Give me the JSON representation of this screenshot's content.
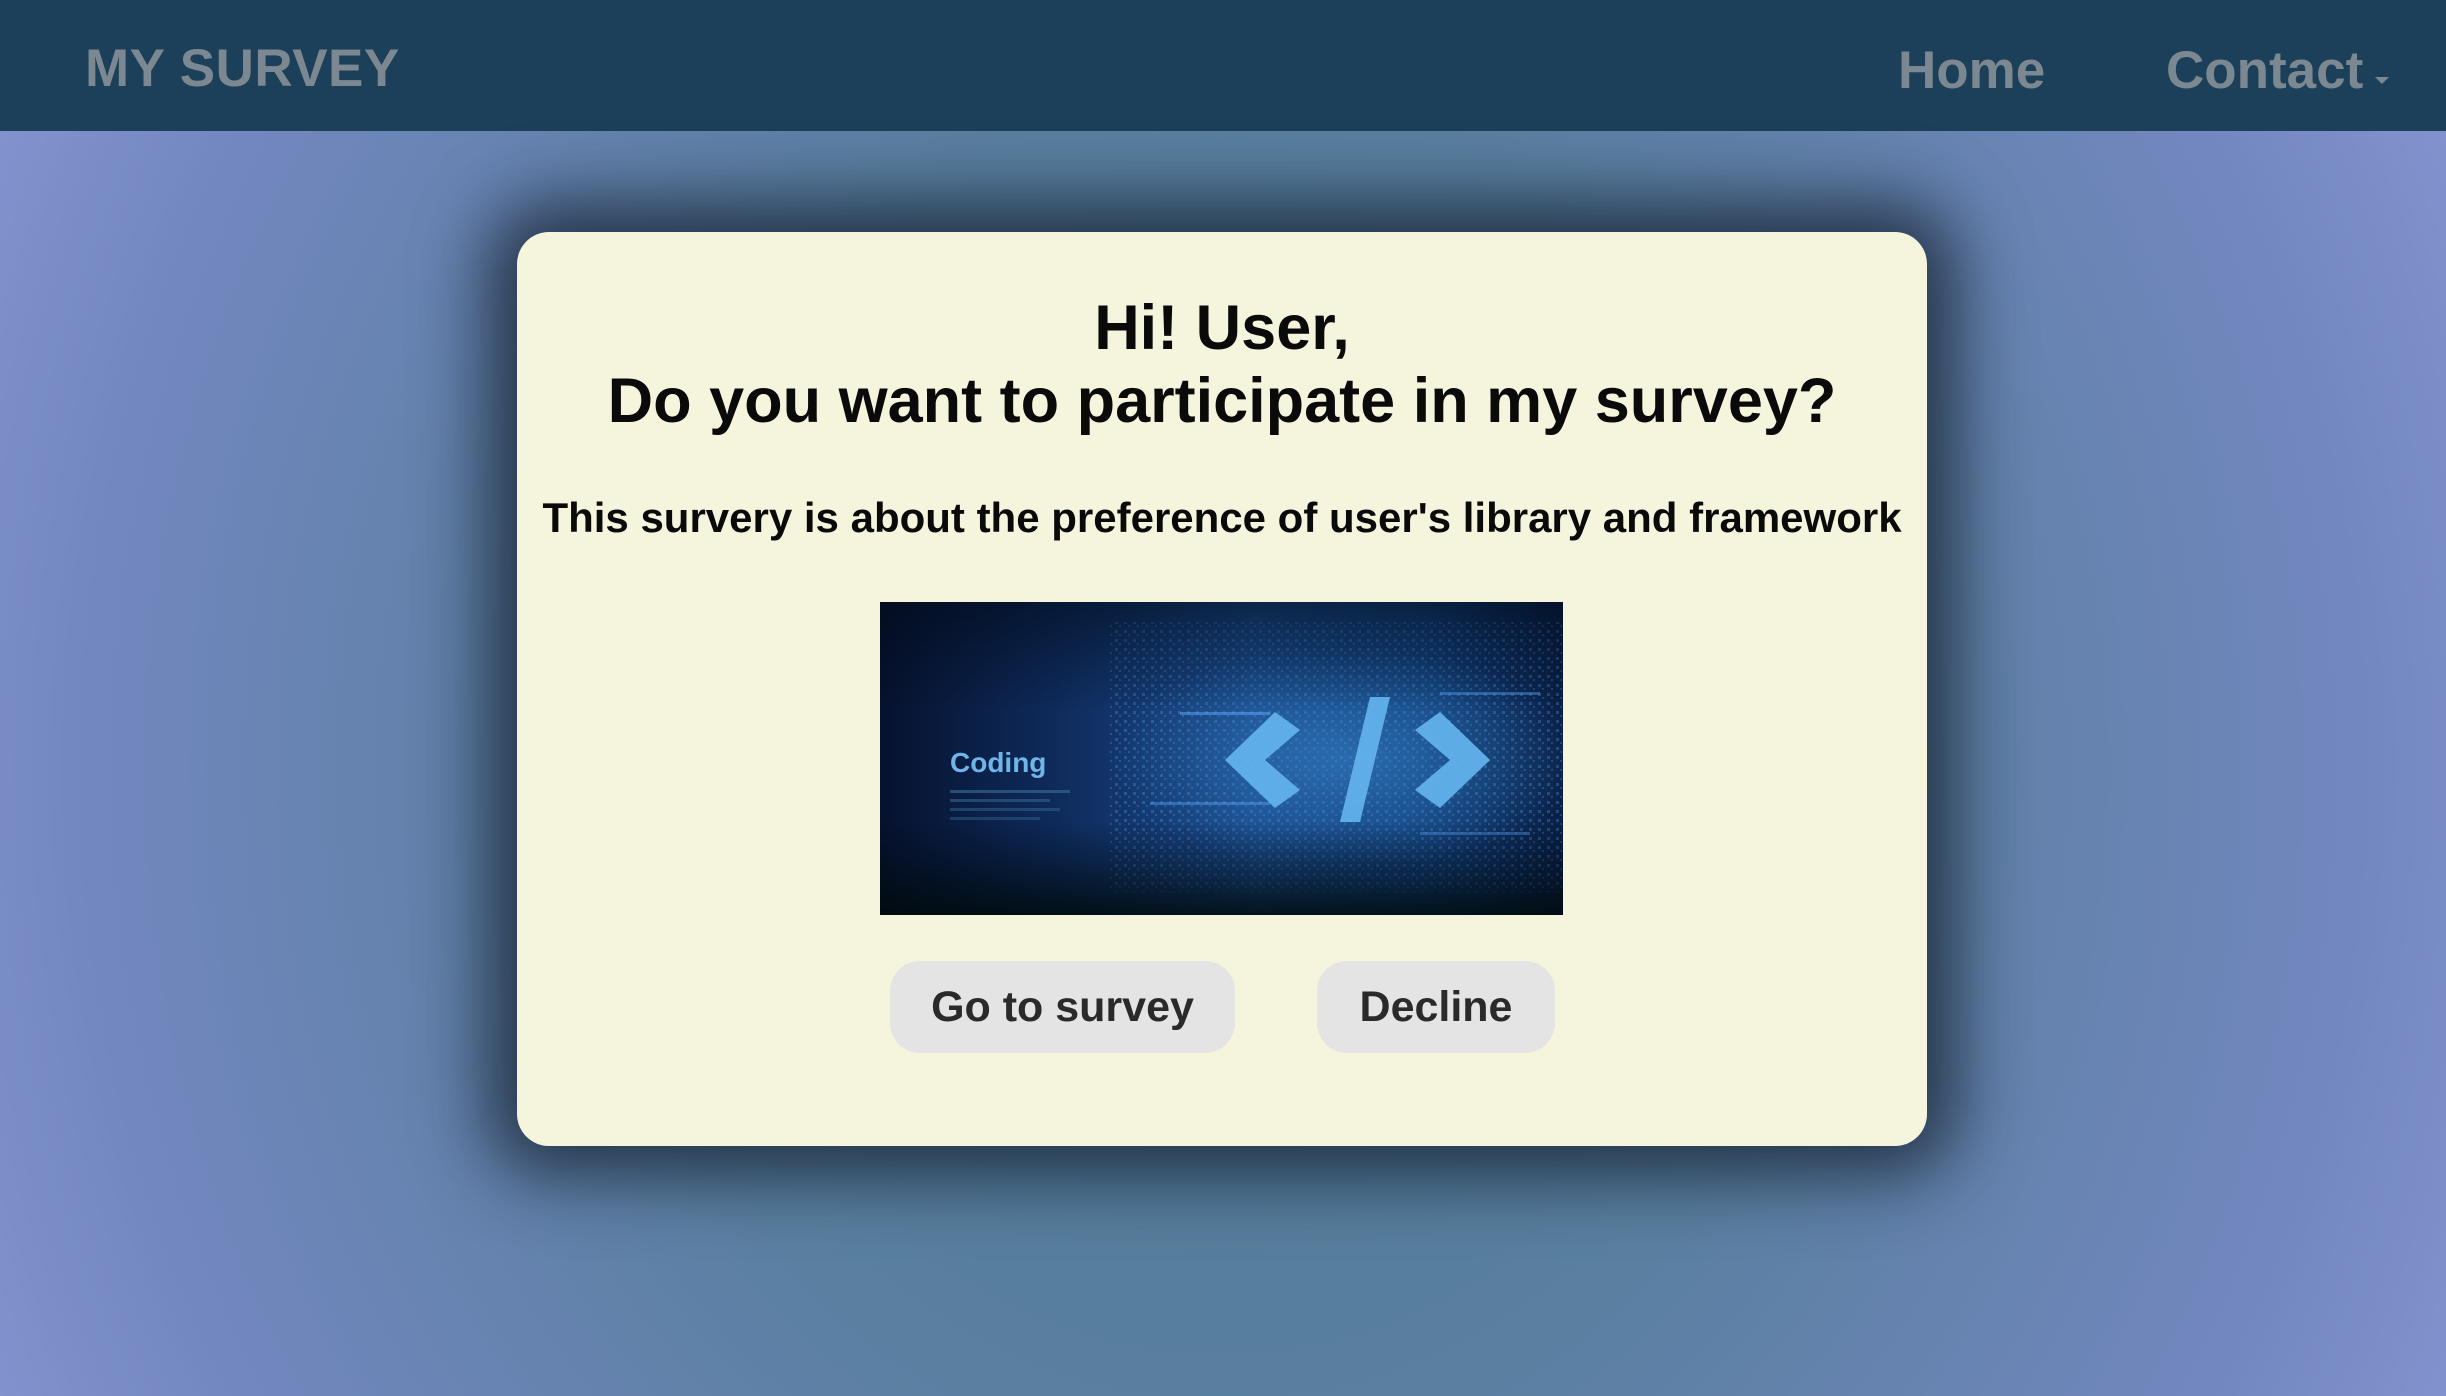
{
  "navbar": {
    "brand": "MY SURVEY",
    "links": [
      {
        "label": "Home"
      },
      {
        "label": "Contact"
      }
    ]
  },
  "modal": {
    "title_line1": "Hi! User,",
    "title_line2": "Do you want to participate in my survey?",
    "subtitle": "This survery is about the preference of user's library and framework",
    "image": {
      "label": "Coding",
      "symbol": "</>"
    },
    "buttons": {
      "accept": "Go to survey",
      "decline": "Decline"
    }
  },
  "colors": {
    "navbar_bg": "#1c4059",
    "nav_text": "#7c8891",
    "modal_bg": "#f5f5de",
    "button_bg": "#e4e4e4",
    "page_bg_edge": "#8e9ad8",
    "page_bg_center": "#4f7a96"
  },
  "icons": {
    "contact_dropdown": "caret-down-icon"
  }
}
